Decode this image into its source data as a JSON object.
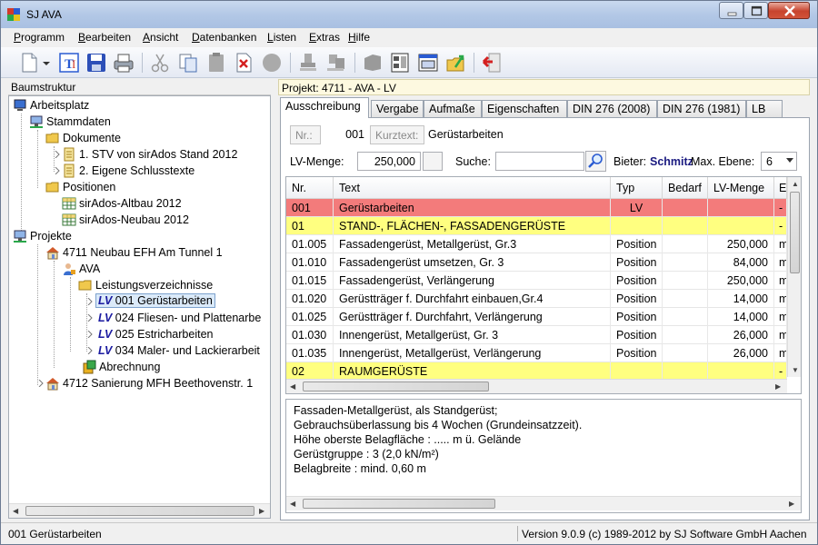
{
  "window": {
    "title": "SJ AVA"
  },
  "menu": [
    {
      "label": "Programm",
      "key": "P"
    },
    {
      "label": "Bearbeiten",
      "key": "B"
    },
    {
      "label": "Ansicht",
      "key": "A"
    },
    {
      "label": "Datenbanken",
      "key": "D"
    },
    {
      "label": "Listen",
      "key": "L"
    },
    {
      "label": "Extras",
      "key": "E"
    },
    {
      "label": "Hilfe",
      "key": "H"
    }
  ],
  "left_panel": {
    "header": "Baumstruktur",
    "tree": [
      {
        "label": "Arbeitsplatz"
      },
      {
        "label": "Stammdaten"
      },
      {
        "label": "Dokumente"
      },
      {
        "label": "1. STV von sirAdos Stand 2012"
      },
      {
        "label": "2. Eigene Schlusstexte"
      },
      {
        "label": "Positionen"
      },
      {
        "label": "sirAdos-Altbau 2012"
      },
      {
        "label": "sirAdos-Neubau 2012"
      },
      {
        "label": "Projekte"
      },
      {
        "label": "4711 Neubau EFH Am Tunnel 1"
      },
      {
        "label": "AVA"
      },
      {
        "label": "Leistungsverzeichnisse"
      },
      {
        "tag": "LV",
        "label": "001 Gerüstarbeiten"
      },
      {
        "tag": "LV",
        "label": "024 Fliesen- und Plattenarbe"
      },
      {
        "tag": "LV",
        "label": "025 Estricharbeiten"
      },
      {
        "tag": "LV",
        "label": "034 Maler- und Lackierarbeit"
      },
      {
        "label": "Abrechnung"
      },
      {
        "label": "4712 Sanierung MFH Beethovenstr. 1"
      }
    ]
  },
  "right_panel": {
    "header": "Projekt: 4711 - AVA - LV",
    "tabs": [
      "Ausschreibung",
      "Vergabe",
      "Aufmaße",
      "Eigenschaften",
      "DIN 276 (2008)",
      "DIN 276 (1981)",
      "LB"
    ],
    "nr_label": "Nr.:",
    "nr_value": "001",
    "kurztext_label": "Kurztext:",
    "kurztext_value": "Gerüstarbeiten",
    "lv_menge_label": "LV-Menge:",
    "lv_menge_value": "250,000",
    "suche_label": "Suche:",
    "suche_value": "",
    "bieter_label": "Bieter:",
    "bieter_value": "Schmitz",
    "max_ebene_label": "Max. Ebene:",
    "max_ebene_value": "6"
  },
  "grid": {
    "columns": [
      "Nr.",
      "Text",
      "Typ",
      "Bedarf",
      "LV-Menge",
      "E"
    ],
    "rows": [
      {
        "nr": "001",
        "text": "Gerüstarbeiten",
        "typ": "LV",
        "bedarf": "",
        "menge": "",
        "e": "-",
        "style": "red"
      },
      {
        "nr": "01",
        "text": "STAND-, FLÄCHEN-, FASSADENGERÜSTE",
        "typ": "",
        "bedarf": "",
        "menge": "",
        "e": "-",
        "style": "yellow"
      },
      {
        "nr": "01.005",
        "text": "Fassadengerüst, Metallgerüst, Gr.3",
        "typ": "Position",
        "bedarf": "",
        "menge": "250,000",
        "e": "m",
        "style": ""
      },
      {
        "nr": "01.010",
        "text": "Fassadengerüst umsetzen, Gr. 3",
        "typ": "Position",
        "bedarf": "",
        "menge": "84,000",
        "e": "m",
        "style": ""
      },
      {
        "nr": "01.015",
        "text": "Fassadengerüst, Verlängerung",
        "typ": "Position",
        "bedarf": "",
        "menge": "250,000",
        "e": "m",
        "style": ""
      },
      {
        "nr": "01.020",
        "text": "Gerüstträger f. Durchfahrt einbauen,Gr.4",
        "typ": "Position",
        "bedarf": "",
        "menge": "14,000",
        "e": "m",
        "style": ""
      },
      {
        "nr": "01.025",
        "text": "Gerüstträger f. Durchfahrt, Verlängerung",
        "typ": "Position",
        "bedarf": "",
        "menge": "14,000",
        "e": "m",
        "style": ""
      },
      {
        "nr": "01.030",
        "text": "Innengerüst, Metallgerüst, Gr. 3",
        "typ": "Position",
        "bedarf": "",
        "menge": "26,000",
        "e": "m",
        "style": ""
      },
      {
        "nr": "01.035",
        "text": "Innengerüst, Metallgerüst, Verlängerung",
        "typ": "Position",
        "bedarf": "",
        "menge": "26,000",
        "e": "m",
        "style": ""
      },
      {
        "nr": "02",
        "text": "RAUMGERÜSTE",
        "typ": "",
        "bedarf": "",
        "menge": "",
        "e": "-",
        "style": "yellow"
      }
    ]
  },
  "description": {
    "lines": [
      "Fassaden-Metallgerüst, als Standgerüst;",
      "Gebrauchsüberlassung bis 4 Wochen (Grundeinsatzzeit).",
      "Höhe oberste Belagfläche : ..... m ü. Gelände",
      "Gerüstgruppe : 3 (2,0 kN/m²)",
      "Belagbreite : mind. 0,60 m"
    ]
  },
  "status": {
    "left": "001 Gerüstarbeiten",
    "right": "Version 9.0.9 (c) 1989-2012 by SJ Software GmbH Aachen"
  },
  "colors": {
    "row_red": "#f37b7b",
    "row_yellow": "#ffff80",
    "accent": "#1a1aa0",
    "header_yellow": "#fdf9e0"
  },
  "toolbar_icons": [
    "new-document-icon",
    "dropdown-arrow-icon",
    "text-edit-icon",
    "save-icon",
    "print-icon",
    "cut-icon",
    "copy-icon",
    "paste-icon",
    "delete-icon",
    "circle-icon",
    "stamp-icon",
    "stamp2-icon",
    "flag-icon",
    "layout-icon",
    "window-icon",
    "export-icon",
    "exit-icon"
  ]
}
